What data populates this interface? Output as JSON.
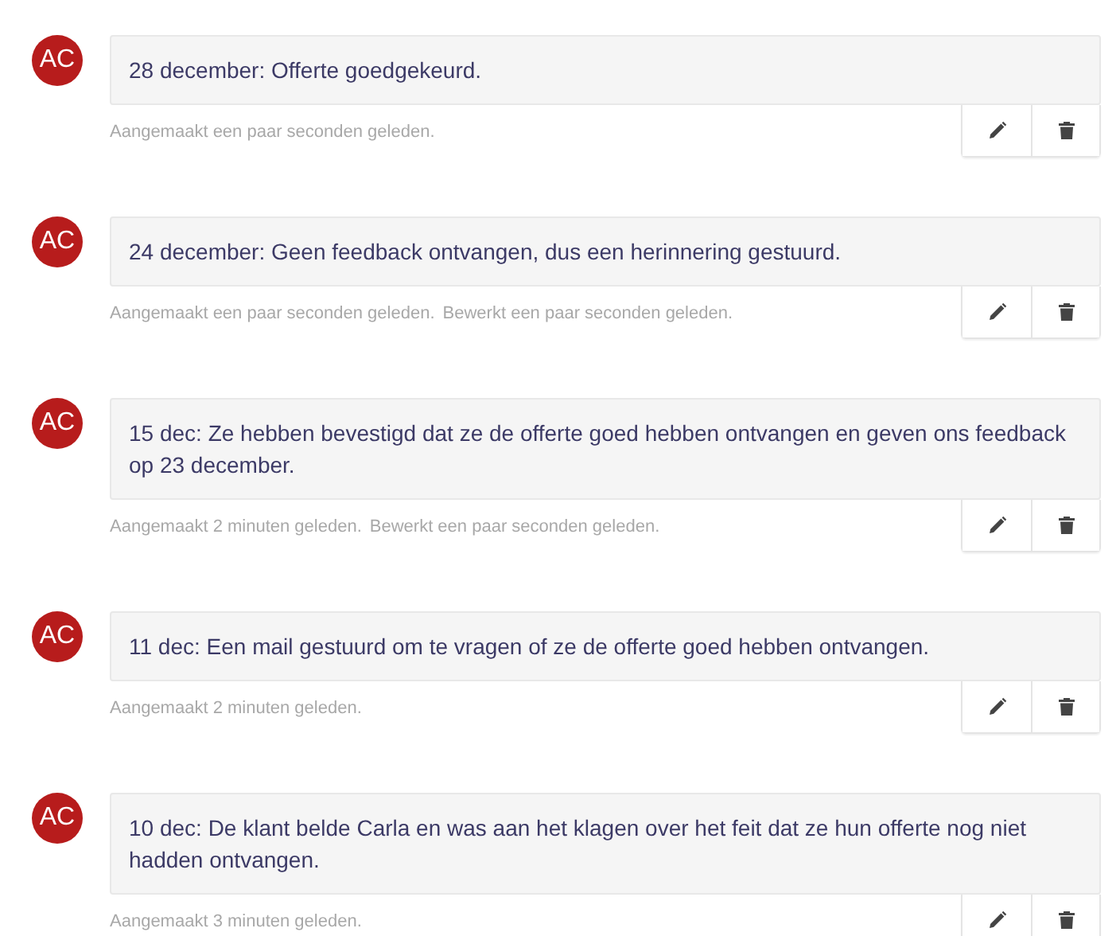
{
  "comments": [
    {
      "initials": "AC",
      "text": "28 december: Offerte goedgekeurd.",
      "created": "Aangemaakt een paar seconden geleden."
    },
    {
      "initials": "AC",
      "text": "24 december: Geen feedback ontvangen, dus een herinnering gestuurd.",
      "created": "Aangemaakt een paar seconden geleden.",
      "edited": "Bewerkt een paar seconden geleden."
    },
    {
      "initials": "AC",
      "text": "15 dec: Ze hebben bevestigd dat ze de offerte goed hebben ontvangen en geven ons feedback op 23 december.",
      "created": "Aangemaakt 2 minuten geleden.",
      "edited": "Bewerkt een paar seconden geleden."
    },
    {
      "initials": "AC",
      "text": "11 dec: Een mail gestuurd om te vragen of ze de offerte goed hebben ontvangen.",
      "created": "Aangemaakt 2 minuten geleden."
    },
    {
      "initials": "AC",
      "text": "10 dec: De klant belde Carla en was aan het klagen over het feit dat ze hun offerte nog niet hadden ontvangen.",
      "created": "Aangemaakt 3 minuten geleden."
    }
  ]
}
